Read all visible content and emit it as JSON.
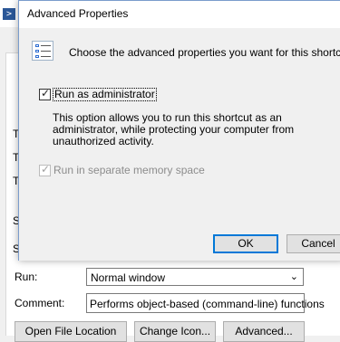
{
  "background_window": {
    "side_labels": [
      "T",
      "T",
      "T",
      "S",
      "S"
    ],
    "run_label": "Run:",
    "run_value": "Normal window",
    "comment_label": "Comment:",
    "comment_value": "Performs object-based (command-line) functions",
    "buttons": [
      "Open File Location",
      "Change Icon...",
      "Advanced..."
    ]
  },
  "dialog": {
    "title": "Advanced Properties",
    "intro": "Choose the advanced properties you want for this shortcut.",
    "run_as_admin": {
      "label": "Run as administrator",
      "checked": true
    },
    "description": "This option allows you to run this shortcut as an administrator, while protecting your computer from unauthorized activity.",
    "separate_memory": {
      "label": "Run in separate memory space",
      "checked": true,
      "disabled": true
    },
    "ok_label": "OK",
    "cancel_label": "Cancel"
  },
  "colors": {
    "accent": "#0078d7",
    "disabled_text": "#8c8c8c"
  }
}
